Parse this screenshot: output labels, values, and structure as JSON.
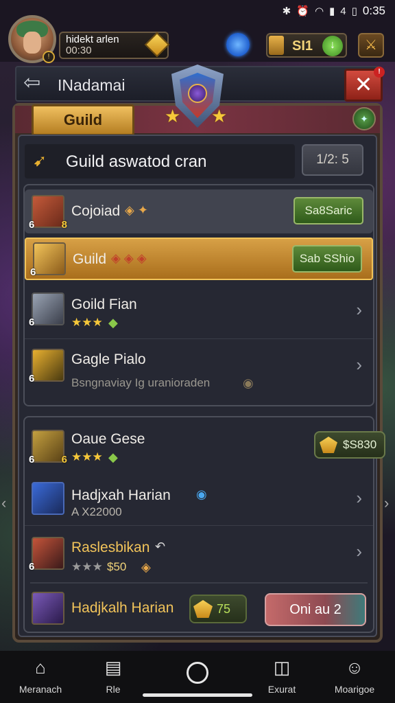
{
  "status_bar": {
    "icons": [
      "bluetooth-icon",
      "alarm-icon",
      "wifi-icon",
      "signal-icon",
      "battery-icon"
    ],
    "signal_label": "4",
    "time": "0:35"
  },
  "player": {
    "name": "hidekt arlen",
    "id": "00:30"
  },
  "resources": {
    "currency_value": "SI1"
  },
  "header": {
    "title": "INadamai"
  },
  "guild_tab": {
    "label": "Guild"
  },
  "section": {
    "title": "Guild aswatod cran",
    "page": "1/2: 5"
  },
  "list_top": [
    {
      "name": "Cojoiad",
      "button": "Sa8Saric"
    },
    {
      "name": "Guild",
      "button": "Sab SShio"
    },
    {
      "name": "Goild Fian",
      "badge": "6",
      "stars": "★★★"
    },
    {
      "name": "Gagle Pialo",
      "sub": "Bsngnaviay Ig uranioraden"
    }
  ],
  "list_bottom": [
    {
      "name": "Oaue Gese",
      "stars": "★★★",
      "cost": "$S830"
    },
    {
      "name": "Hadjxah Harian",
      "sub": "A X22000"
    },
    {
      "name": "Raslesbikan",
      "stars": "★★★",
      "price": "$50"
    }
  ],
  "bottom_row": {
    "name": "Hadjkalh Harian",
    "amount": "75",
    "button": "Oni au 2"
  },
  "nav": [
    {
      "label": "Meranach",
      "icon": "home-icon"
    },
    {
      "label": "Rle",
      "icon": "file-icon"
    },
    {
      "label": "Exurat",
      "icon": "book-icon"
    },
    {
      "label": "Moarigoe",
      "icon": "profile-icon"
    }
  ],
  "colors": {
    "gold": "#e8b030",
    "green_button": "#5e8a3a",
    "close_red": "#d24a3e",
    "panel_bg": "#262833"
  }
}
